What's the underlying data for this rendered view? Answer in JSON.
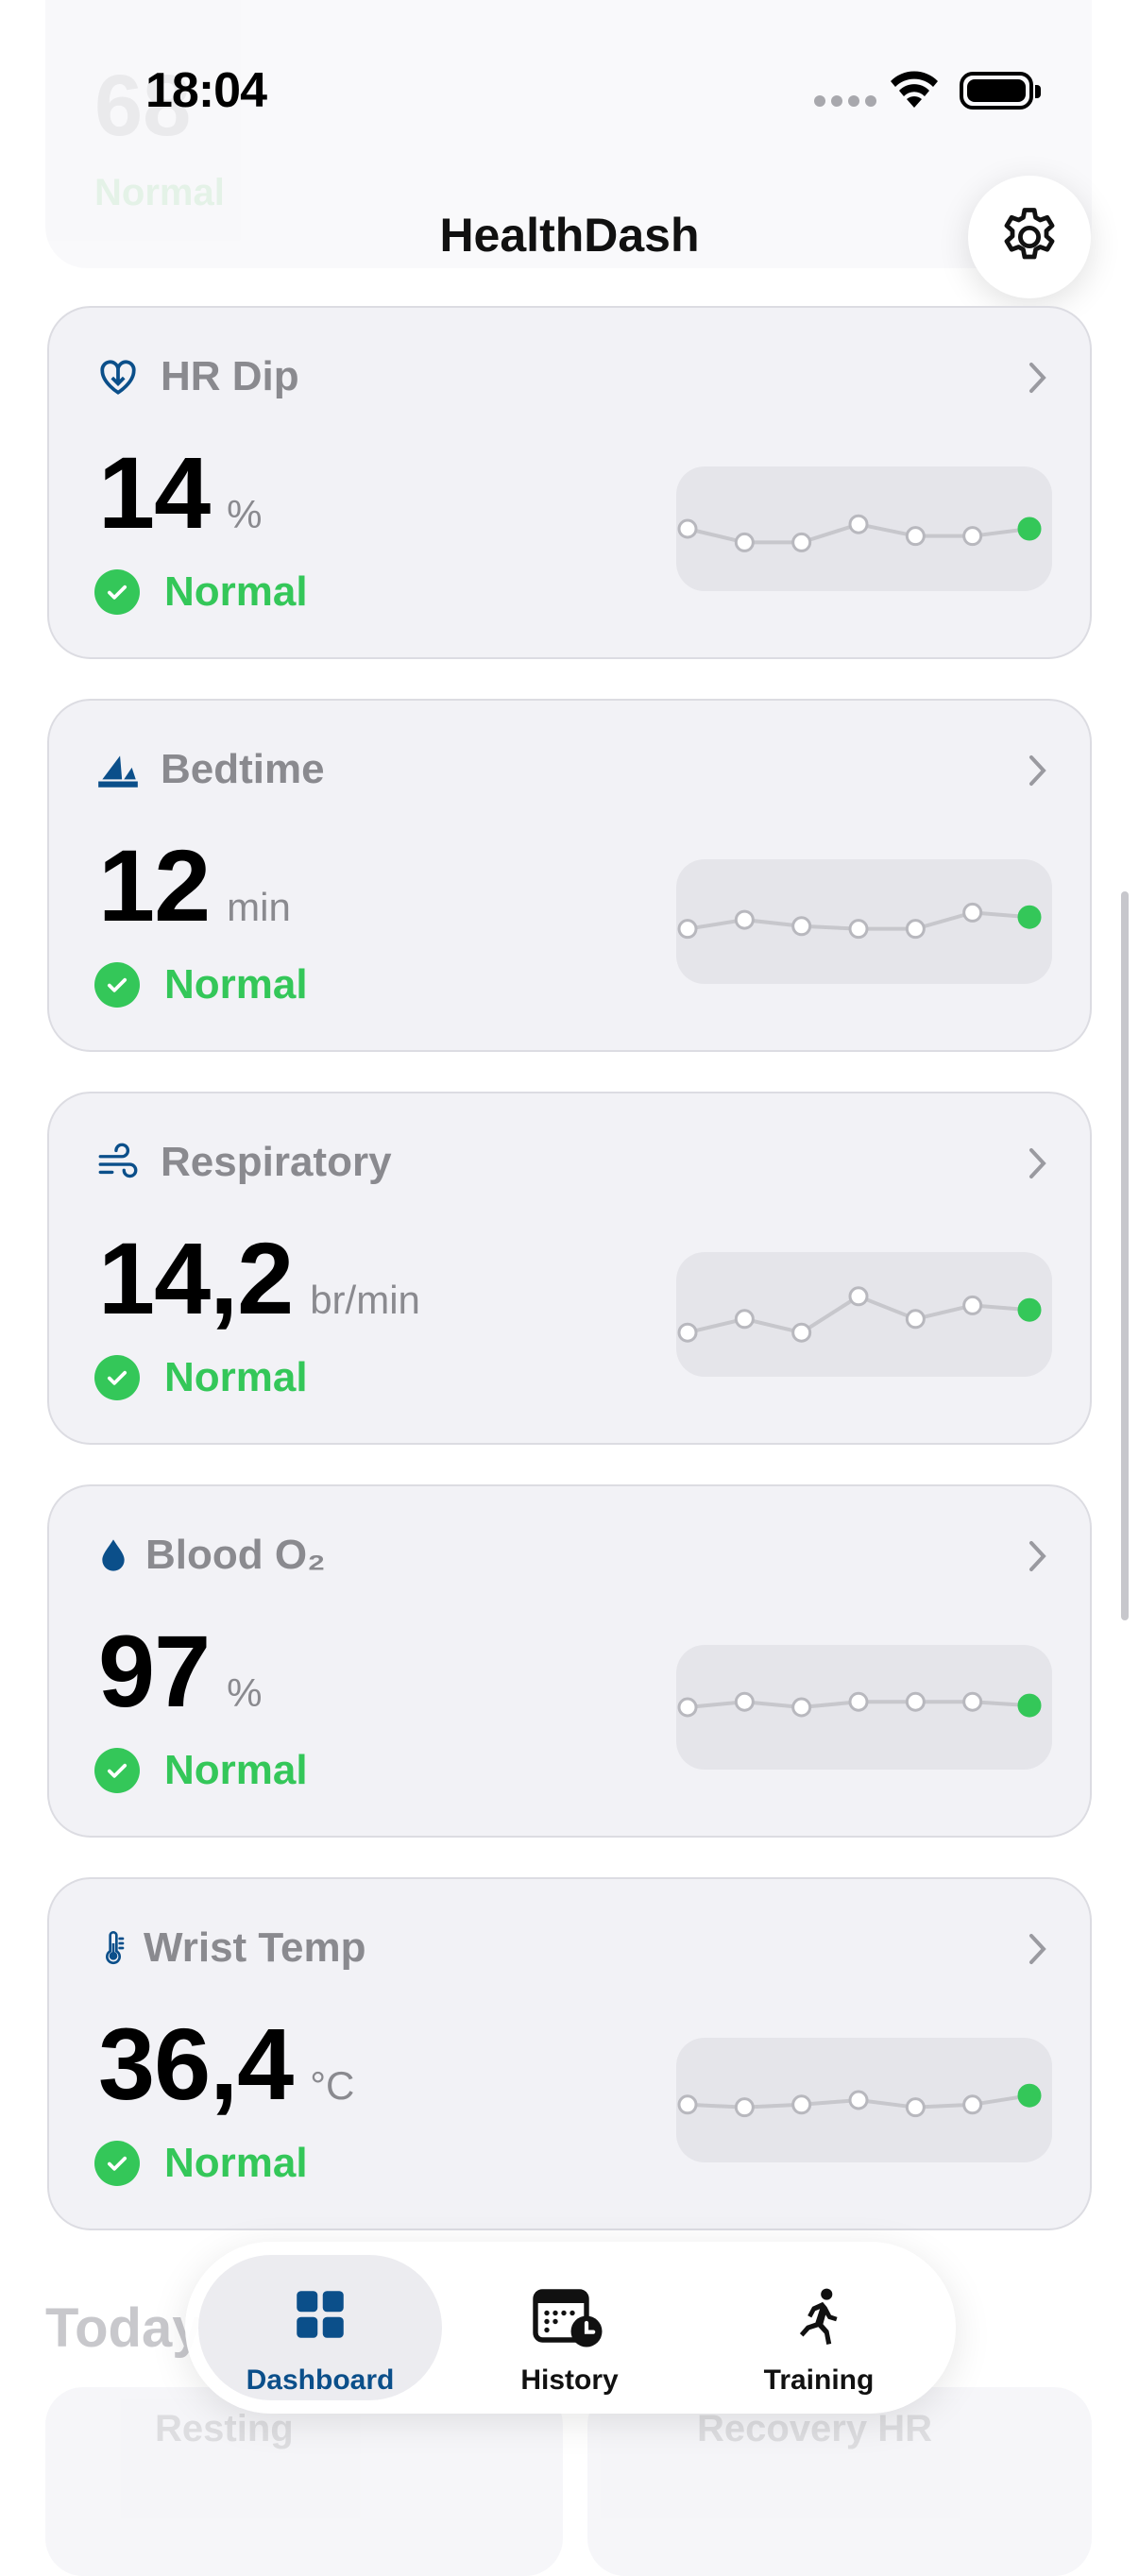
{
  "app": {
    "title": "HealthDash",
    "time": "18:04"
  },
  "ghost_top": {
    "value": "68",
    "status": "Normal"
  },
  "cards": [
    {
      "title": "HR Dip",
      "value": "14",
      "unit": "%",
      "status": "Normal",
      "icon": "heart-down-icon",
      "trend": [
        0.5,
        0.35,
        0.35,
        0.55,
        0.42,
        0.42,
        0.5
      ]
    },
    {
      "title": "Bedtime",
      "value": "12",
      "unit": "min",
      "status": "Normal",
      "icon": "bedtime-icon",
      "trend": [
        0.42,
        0.52,
        0.45,
        0.42,
        0.42,
        0.6,
        0.55
      ]
    },
    {
      "title": "Respiratory",
      "value": "14,2",
      "unit": "br/min",
      "status": "Normal",
      "icon": "wind-icon",
      "trend": [
        0.3,
        0.45,
        0.3,
        0.7,
        0.45,
        0.6,
        0.55
      ]
    },
    {
      "title": "Blood O₂",
      "value": "97",
      "unit": "%",
      "status": "Normal",
      "icon": "drop-icon",
      "trend": [
        0.5,
        0.56,
        0.5,
        0.56,
        0.56,
        0.56,
        0.52
      ]
    },
    {
      "title": "Wrist Temp",
      "value": "36,4",
      "unit": "°C",
      "status": "Normal",
      "icon": "thermometer-icon",
      "trend": [
        0.45,
        0.42,
        0.45,
        0.5,
        0.42,
        0.45,
        0.55
      ]
    }
  ],
  "section": {
    "today": "Today"
  },
  "below_cards": [
    {
      "label": "Resting"
    },
    {
      "label": "Recovery HR"
    }
  ],
  "tabs": [
    {
      "label": "Dashboard",
      "active": true,
      "icon": "grid-icon"
    },
    {
      "label": "History",
      "active": false,
      "icon": "calendar-clock-icon"
    },
    {
      "label": "Training",
      "active": false,
      "icon": "running-icon"
    }
  ],
  "colors": {
    "accent": "#0b4f8a",
    "normal": "#34c759",
    "sparkline": "#c7c7cc"
  }
}
